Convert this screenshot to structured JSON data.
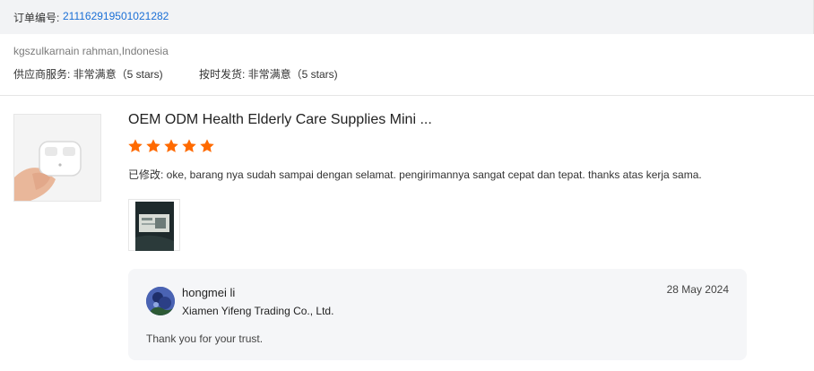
{
  "order": {
    "label": "订单编号:",
    "number": "211162919501021282"
  },
  "buyer": {
    "name": "kgszulkarnain rahman,Indonesia"
  },
  "ratings": {
    "supplier_service": "供应商服务: 非常满意（5 stars)",
    "on_time_shipment": "按时发货: 非常满意（5 stars)"
  },
  "product": {
    "title": "OEM ODM Health Elderly Care Supplies Mini ...",
    "rating": 5,
    "star_color": "#ff6a00",
    "comment": "已修改: oke, barang nya sudah sampai dengan selamat. pengirimannya sangat cepat dan tepat. thanks atas kerja sama."
  },
  "reply": {
    "name": "hongmei li",
    "company": "Xiamen Yifeng Trading Co., Ltd.",
    "date": "28 May 2024",
    "message": "Thank you for your trust."
  }
}
